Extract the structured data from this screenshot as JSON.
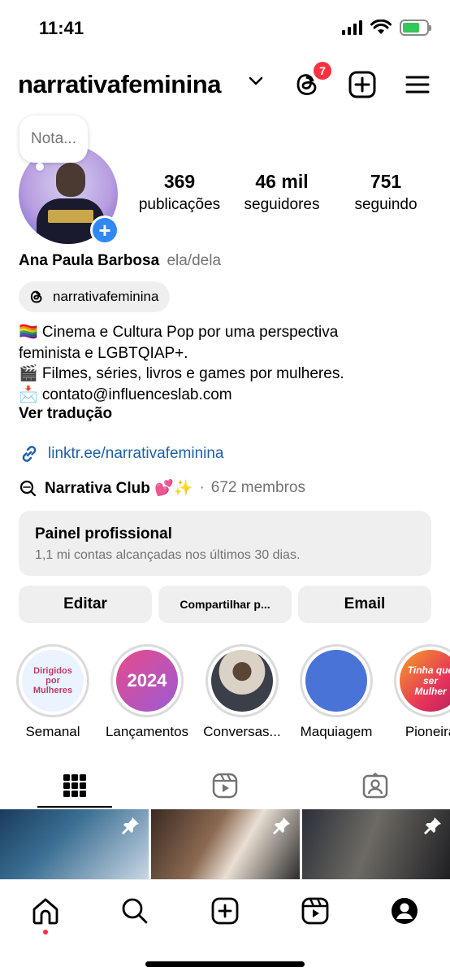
{
  "status_bar": {
    "time": "11:41",
    "icons": [
      "signal-icon",
      "wifi-icon",
      "battery-charging-icon"
    ],
    "battery_color": "#34c759"
  },
  "header": {
    "username": "narrativafeminina",
    "threads_badge": "7",
    "badge_color": "#ff3040",
    "icons": [
      "chevron-down-icon",
      "threads-icon",
      "add-post-icon",
      "hamburger-menu-icon"
    ]
  },
  "profile": {
    "note_placeholder": "Nota...",
    "stats": [
      {
        "value": "369",
        "label": "publicações"
      },
      {
        "value": "46 mil",
        "label": "seguidores"
      },
      {
        "value": "751",
        "label": "seguindo"
      }
    ],
    "name": "Ana Paula Barbosa",
    "pronouns": "ela/dela",
    "threads_handle": "narrativafeminina",
    "bio_lines": [
      "🏳️‍🌈 Cinema e Cultura Pop por uma perspectiva",
      "feminista e LGBTQIAP+.",
      "🎬 Filmes, séries, livros e games por mulheres.",
      "📩 contato@influenceslab.com"
    ],
    "translate": "Ver tradução",
    "link": "linktr.ee/narrativafeminina",
    "link_color": "#1e5fa8",
    "club_name": "Narrativa Club 💕✨",
    "club_separator": "·",
    "club_members": "672 membros"
  },
  "pro_panel": {
    "title": "Painel profissional",
    "subtitle": "1,1 mi contas alcançadas nos últimos 30 dias."
  },
  "actions": {
    "edit": "Editar",
    "share": "Compartilhar p...",
    "email": "Email"
  },
  "highlights": [
    {
      "label": "Semanal",
      "cover_text": "Dirigidos por Mulheres"
    },
    {
      "label": "Lançamentos",
      "cover_text": "2024"
    },
    {
      "label": "Conversas...",
      "cover_text": ""
    },
    {
      "label": "Maquiagem",
      "cover_text": ""
    },
    {
      "label": "Pioneira",
      "cover_text": "Tinha que ser Mulher"
    }
  ],
  "tabs": {
    "active": "grid",
    "icons": [
      "grid-icon",
      "reels-icon",
      "tagged-icon"
    ]
  },
  "grid": {
    "pinned_count": 3
  },
  "bottom_nav": {
    "icons": [
      "home-icon",
      "search-icon",
      "create-icon",
      "reels-icon",
      "profile-icon"
    ],
    "active": "home"
  }
}
